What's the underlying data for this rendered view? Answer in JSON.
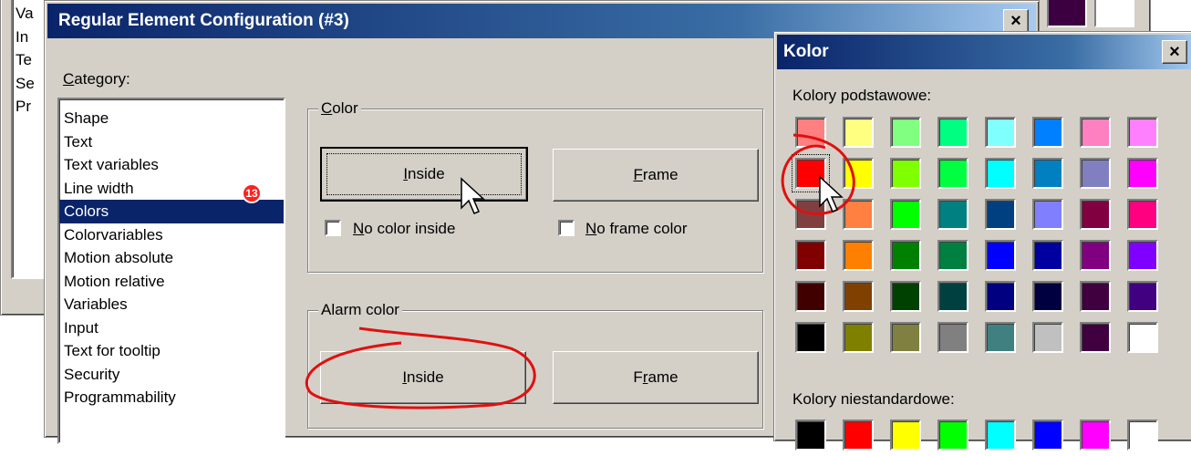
{
  "background_window": {
    "left_labels": [
      "Va",
      "In",
      "Te",
      "Se",
      "Pr"
    ]
  },
  "config_dialog": {
    "title": "Regular Element Configuration (#3)",
    "close_label": "×",
    "category_label": "Category:",
    "categories": [
      "Shape",
      "Text",
      "Text variables",
      "Line width",
      "Colors",
      "Colorvariables",
      "Motion absolute",
      "Motion relative",
      "Variables",
      "Input",
      "Text for tooltip",
      "Security",
      "Programmability"
    ],
    "selected_category": "Colors",
    "step_badge": "13",
    "color_group": {
      "title": "Color",
      "inside_button": "Inside",
      "frame_button": "Frame",
      "no_color_inside": "No color inside",
      "no_frame_color": "No frame color"
    },
    "alarm_group": {
      "title": "Alarm color",
      "inside_button": "Inside",
      "frame_button": "Frame"
    }
  },
  "top_swatches": [
    "#3c0040",
    "#ffffff"
  ],
  "kolor_dialog": {
    "title": "Kolor",
    "close_label": "×",
    "basic_label": "Kolory podstawowe:",
    "custom_label": "Kolory niestandardowe:",
    "selected_swatch": "#ff0000",
    "basic_colors": [
      [
        "#ff8080",
        "#ffff80",
        "#80ff80",
        "#00ff80",
        "#80ffff",
        "#0080ff",
        "#ff80c0",
        "#ff80ff"
      ],
      [
        "#ff0000",
        "#ffff00",
        "#80ff00",
        "#00ff40",
        "#00ffff",
        "#0080c0",
        "#8080c0",
        "#ff00ff"
      ],
      [
        "#804040",
        "#ff8040",
        "#00ff00",
        "#008080",
        "#004080",
        "#8080ff",
        "#800040",
        "#ff0080"
      ],
      [
        "#800000",
        "#ff8000",
        "#008000",
        "#008040",
        "#0000ff",
        "#0000a0",
        "#800080",
        "#8000ff"
      ],
      [
        "#400000",
        "#804000",
        "#004000",
        "#004040",
        "#000080",
        "#000040",
        "#400040",
        "#400080"
      ],
      [
        "#000000",
        "#808000",
        "#808040",
        "#808080",
        "#408080",
        "#c0c0c0",
        "#400040",
        "#ffffff"
      ]
    ],
    "custom_colors": [
      "#000000",
      "#ff0000",
      "#ffff00",
      "#00ff00",
      "#00ffff",
      "#0000ff",
      "#ff00ff",
      "#ffffff"
    ]
  },
  "annotation_color": "#e01010"
}
